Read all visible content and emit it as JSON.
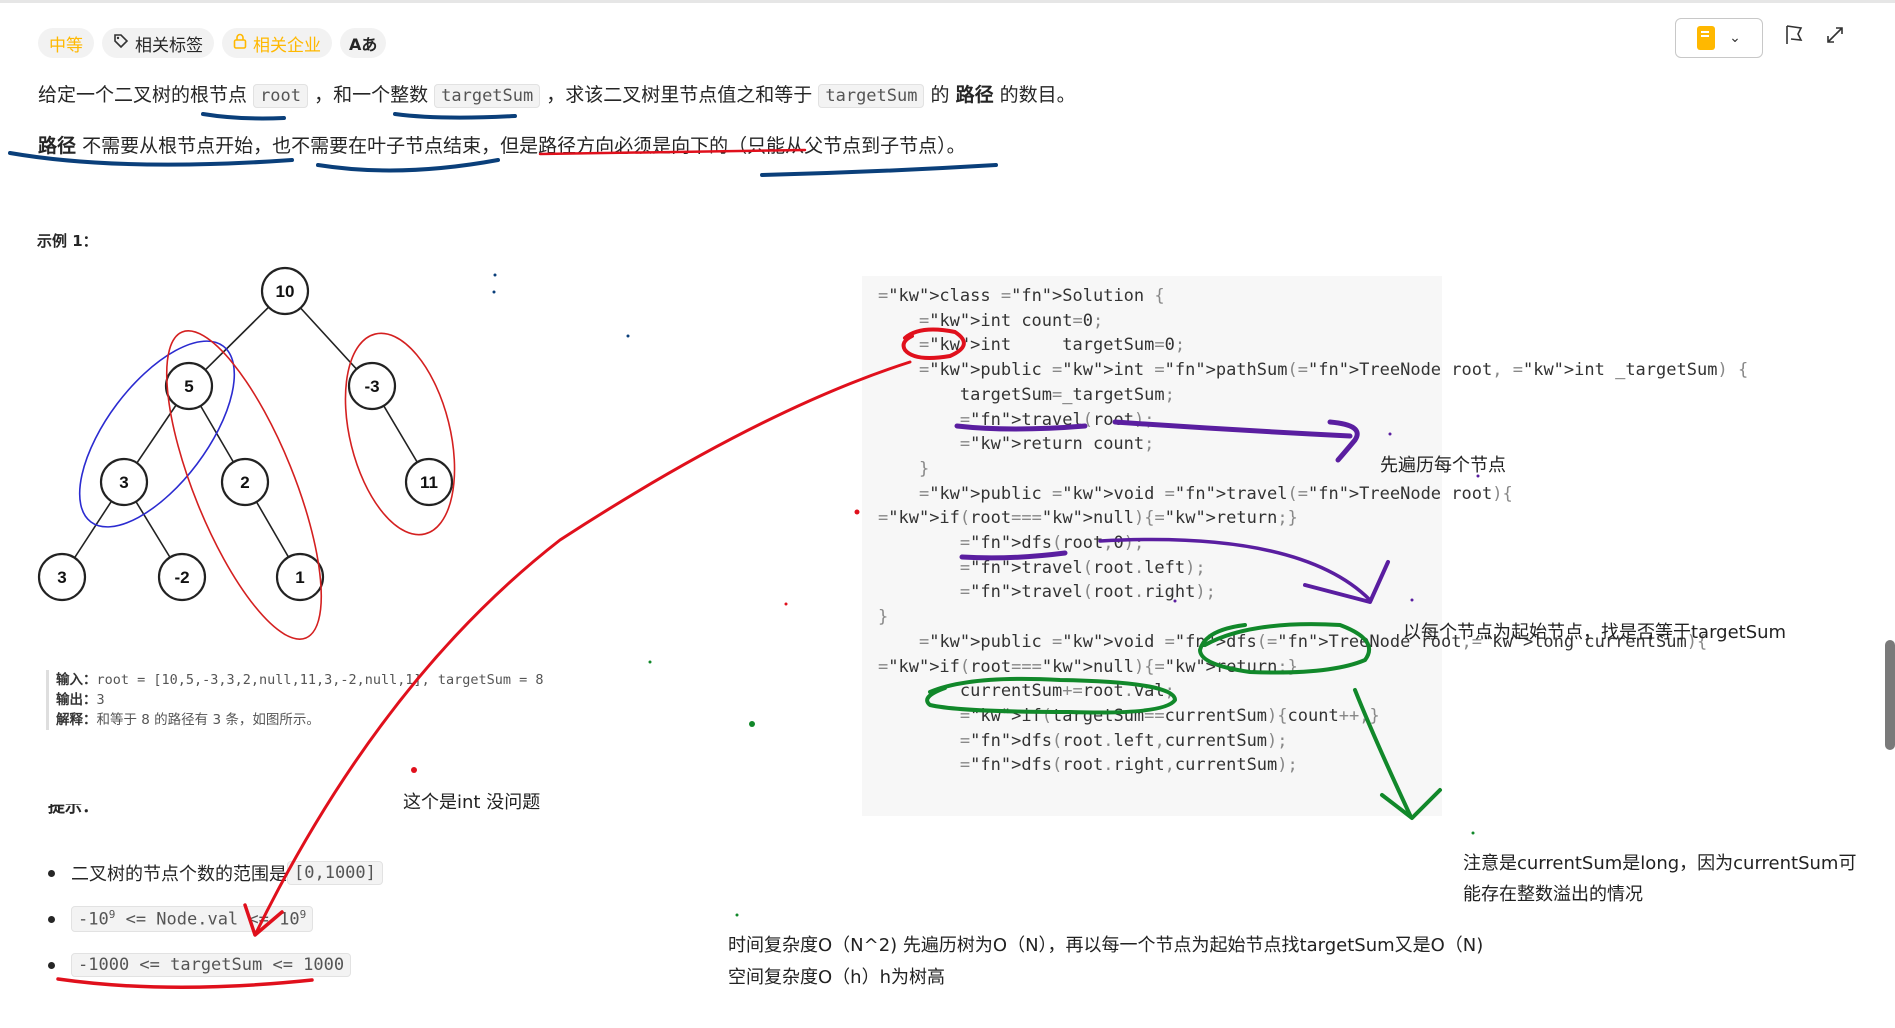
{
  "tags": {
    "difficulty": "中等",
    "related_tags": "相关标签",
    "related_companies": "相关企业",
    "translate": "Aあ"
  },
  "colors": {
    "difficulty": "#ffb800",
    "annotation_red": "#e0101c",
    "annotation_blue": "#0a3f7a",
    "annotation_purple": "#5a1ea0",
    "annotation_green": "#11882a"
  },
  "description": {
    "p1_a": "给定一个二叉树的根节点",
    "p1_root": "root",
    "p1_b": "，和一个整数",
    "p1_target": "targetSum",
    "p1_c": "，求该二叉树里节点值之和等于",
    "p1_target2": "targetSum",
    "p1_d": "的",
    "p1_path": "路径",
    "p1_e": "的数目。",
    "p2_path": "路径",
    "p2_rest": "不需要从根节点开始，也不需要在叶子节点结束，但是路径方向必须是向下的（只能从父节点到子节点）。"
  },
  "example_title": "示例 1：",
  "tree": {
    "nodes": [
      "10",
      "5",
      "-3",
      "3",
      "2",
      "11",
      "3",
      "-2",
      "1"
    ]
  },
  "io": {
    "input_label": "输入：",
    "input_value": "root = [10,5,-3,3,2,null,11,3,-2,null,1], targetSum = 8",
    "output_label": "输出：",
    "output_value": "3",
    "explain_label": "解释：",
    "explain_value": "和等于 8 的路径有 3 条，如图所示。"
  },
  "hint_title": "提示：",
  "hints": {
    "h1_text": "二叉树的节点个数的范围是",
    "h1_code": "[0,1000]",
    "h2_a": "-10",
    "h2_exp1": "9",
    "h2_b": " <= Node.val <= 10",
    "h2_exp2": "9",
    "h3_code": "-1000 <= targetSum <= 1000"
  },
  "code_lines": [
    "class Solution {",
    "    int count=0;",
    "    int     targetSum=0;",
    "    public int pathSum(TreeNode root, int _targetSum) {",
    "        targetSum=_targetSum;",
    "        travel(root);",
    "        return count;",
    "    }",
    "    public void travel(TreeNode root){",
    "if(root==null){return;}",
    "        dfs(root,0);",
    "        travel(root.left);",
    "        travel(root.right);",
    "}",
    "    public void dfs(TreeNode root,long currentSum){",
    "if(root==null){return;}",
    "        currentSum+=root.val;",
    "        if(targetSum==currentSum){count++;}",
    "        dfs(root.left,currentSum);",
    "        dfs(root.right,currentSum);"
  ],
  "annotations": {
    "traverse_each": "先遍历每个节点",
    "each_as_start": "以每个节点为起始节点，找是否等于targetSum",
    "int_ok": "这个是int 没问题",
    "long_note_1": "注意是currentSum是long，因为currentSum可",
    "long_note_2": "能存在整数溢出的情况",
    "time_complexity": "时间复杂度O（N^2) 先遍历树为O（N），再以每一个节点为起始节点找targetSum又是O（N)",
    "space_complexity": "空间复杂度O（h）h为树高"
  }
}
